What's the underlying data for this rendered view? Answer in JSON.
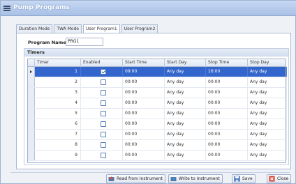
{
  "window": {
    "title": "Pump Programs"
  },
  "tabs": [
    {
      "label": "Duration Mode",
      "active": false
    },
    {
      "label": "TWA Mode",
      "active": false
    },
    {
      "label": "User Program1",
      "active": true
    },
    {
      "label": "User Program2",
      "active": false
    }
  ],
  "program": {
    "name_label": "Program Name",
    "name_value": "PRG1"
  },
  "timers": {
    "group_label": "Timers",
    "columns": [
      "Timer",
      "Enabled",
      "Start Time",
      "Start Day",
      "Stop Time",
      "Stop Day"
    ],
    "rows": [
      {
        "timer": "1",
        "enabled": true,
        "start_time": "09:00",
        "start_day": "Any day",
        "stop_time": "16:00",
        "stop_day": "Any day",
        "selected": true
      },
      {
        "timer": "2",
        "enabled": false,
        "start_time": "00:00",
        "start_day": "Any day",
        "stop_time": "00:00",
        "stop_day": "Any day",
        "selected": false
      },
      {
        "timer": "3",
        "enabled": false,
        "start_time": "00:00",
        "start_day": "Any day",
        "stop_time": "00:00",
        "stop_day": "Any day",
        "selected": false
      },
      {
        "timer": "4",
        "enabled": false,
        "start_time": "00:00",
        "start_day": "Any day",
        "stop_time": "00:00",
        "stop_day": "Any day",
        "selected": false
      },
      {
        "timer": "5",
        "enabled": false,
        "start_time": "00:00",
        "start_day": "Any day",
        "stop_time": "00:00",
        "stop_day": "Any day",
        "selected": false
      },
      {
        "timer": "6",
        "enabled": false,
        "start_time": "00:00",
        "start_day": "Any day",
        "stop_time": "00:00",
        "stop_day": "Any day",
        "selected": false
      },
      {
        "timer": "7",
        "enabled": false,
        "start_time": "00:00",
        "start_day": "Any day",
        "stop_time": "00:00",
        "stop_day": "Any day",
        "selected": false
      },
      {
        "timer": "8",
        "enabled": false,
        "start_time": "00:00",
        "start_day": "Any day",
        "stop_time": "00:00",
        "stop_day": "Any day",
        "selected": false
      },
      {
        "timer": "9",
        "enabled": false,
        "start_time": "00:00",
        "start_day": "Any day",
        "stop_time": "00:00",
        "stop_day": "Any day",
        "selected": false
      }
    ]
  },
  "buttons": {
    "read": "Read from Instrument",
    "write": "Write to Instrument",
    "save": "Save",
    "close": "Close"
  },
  "colors": {
    "selection": "#3366cc",
    "titlebar": "#a9c1e6"
  }
}
